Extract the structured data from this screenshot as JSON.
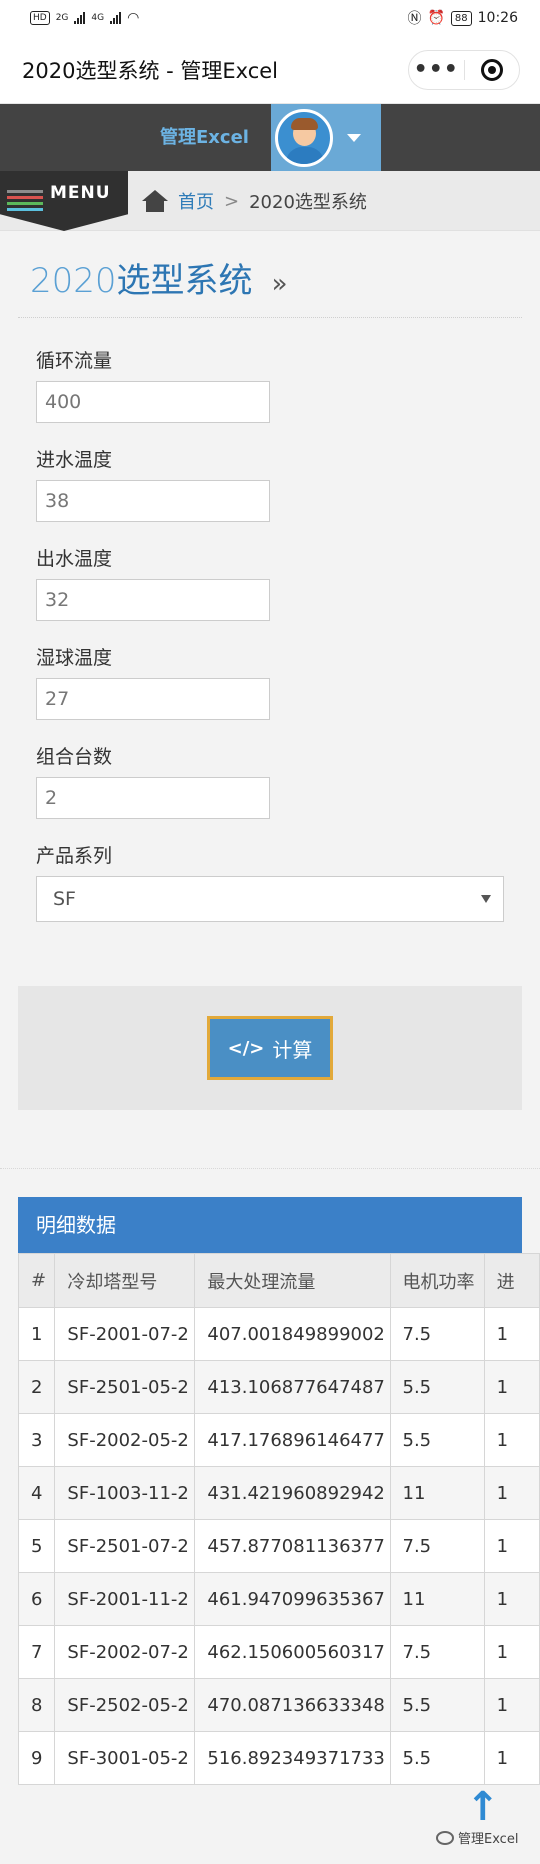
{
  "status_bar": {
    "left_badge": "HD",
    "net1": "2G",
    "net2": "4G",
    "battery": "88",
    "time": "10:26"
  },
  "miniprogram": {
    "title": "2020选型系统 - 管理Excel",
    "more_label": "•••"
  },
  "header": {
    "brand": "管理Excel"
  },
  "menu": {
    "label": "MENU",
    "line_colors": [
      "#8c8c8c",
      "#d9534f",
      "#5cb85c",
      "#5bc0de"
    ]
  },
  "breadcrumb": {
    "home": "首页",
    "separator": ">",
    "current": "2020选型系统"
  },
  "page": {
    "heading_num": "2020",
    "heading_text": "选型系统",
    "heading_suffix": "»"
  },
  "form": {
    "flow": {
      "label": "循环流量",
      "value": "400"
    },
    "inlet_temp": {
      "label": "进水温度",
      "value": "38"
    },
    "outlet_temp": {
      "label": "出水温度",
      "value": "32"
    },
    "wet_bulb": {
      "label": "湿球温度",
      "value": "27"
    },
    "units": {
      "label": "组合台数",
      "value": "2"
    },
    "series": {
      "label": "产品系列",
      "value": "SF"
    }
  },
  "actions": {
    "calc_icon": "</>",
    "calc_label": "计算"
  },
  "detail": {
    "title": "明细数据",
    "columns": [
      "#",
      "冷却塔型号",
      "最大处理流量",
      "电机功率",
      "进"
    ],
    "rows": [
      [
        "1",
        "SF-2001-07-2",
        "407.001849899002",
        "7.5",
        "1"
      ],
      [
        "2",
        "SF-2501-05-2",
        "413.106877647487",
        "5.5",
        "1"
      ],
      [
        "3",
        "SF-2002-05-2",
        "417.176896146477",
        "5.5",
        "1"
      ],
      [
        "4",
        "SF-1003-11-2",
        "431.421960892942",
        "11",
        "1"
      ],
      [
        "5",
        "SF-2501-07-2",
        "457.877081136377",
        "7.5",
        "1"
      ],
      [
        "6",
        "SF-2001-11-2",
        "461.947099635367",
        "11",
        "1"
      ],
      [
        "7",
        "SF-2002-07-2",
        "462.150600560317",
        "7.5",
        "1"
      ],
      [
        "8",
        "SF-2502-05-2",
        "470.087136633348",
        "5.5",
        "1"
      ],
      [
        "9",
        "SF-3001-05-2",
        "516.892349371733",
        "5.5",
        "1"
      ]
    ]
  },
  "footer": {
    "scroll_top": "↑",
    "watermark": "管理Excel"
  }
}
